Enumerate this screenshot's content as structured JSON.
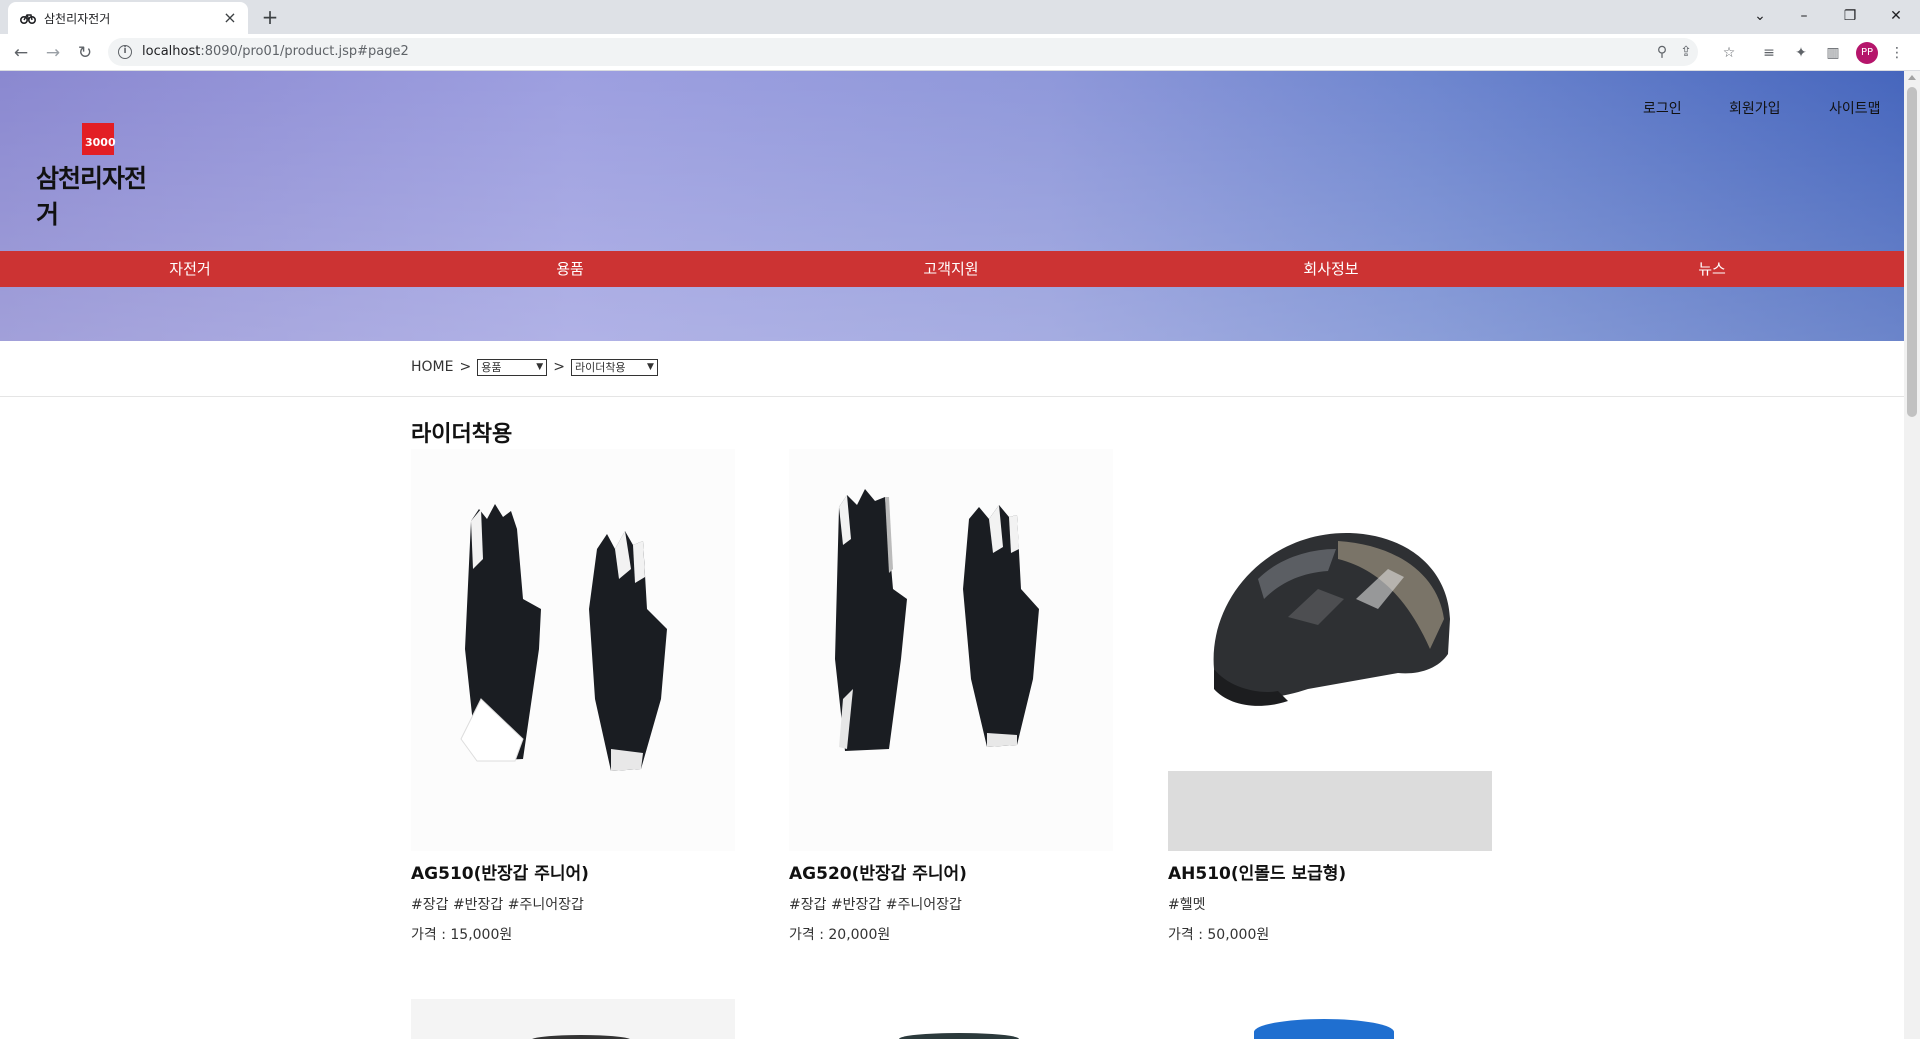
{
  "browser": {
    "tab_title": "삼천리자전거",
    "url_host": "localhost",
    "url_rest": ":8090/pro01/product.jsp#page2",
    "profile_initials": "PP"
  },
  "header": {
    "logo_text": "삼천리자전거",
    "logo_mark": "3000",
    "util_links": [
      "로그인",
      "회원가입",
      "사이트맵"
    ],
    "nav": [
      "자전거",
      "용품",
      "고객지원",
      "회사정보",
      "뉴스"
    ],
    "nav_color": "#cc3333"
  },
  "breadcrumb": {
    "home": "HOME",
    "separator": ">",
    "category": "용품",
    "subcategory": "라이더착용"
  },
  "page_title": "라이더착용",
  "products": [
    {
      "name": "AG510(반장갑 주니어)",
      "tags": "#장갑 #반장갑 #주니어장갑",
      "price": "가격 : 15,000원",
      "image": "gloves-icon"
    },
    {
      "name": "AG520(반장갑 주니어)",
      "tags": "#장갑 #반장갑 #주니어장갑",
      "price": "가격 : 20,000원",
      "image": "gloves-icon"
    },
    {
      "name": "AH510(인몰드 보급형)",
      "tags": "#헬멧",
      "price": "가격 : 50,000원",
      "image": "helmet-icon"
    }
  ]
}
